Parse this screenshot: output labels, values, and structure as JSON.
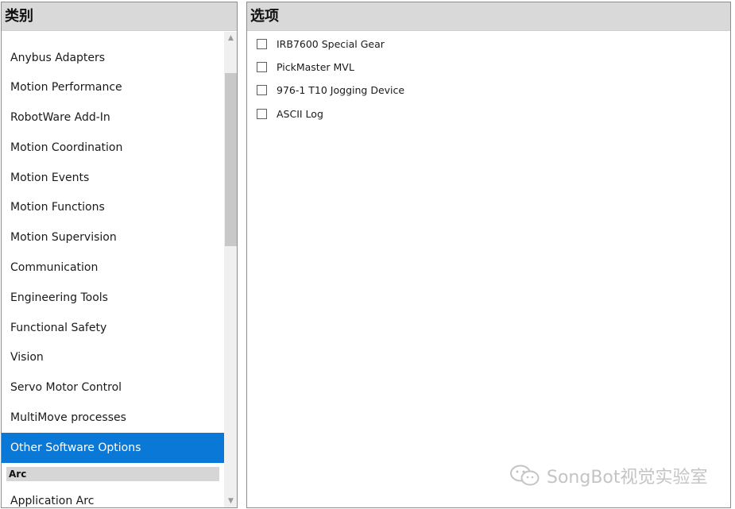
{
  "left_panel": {
    "header": "类别",
    "items": [
      "Anybus Adapters",
      "Motion Performance",
      "RobotWare Add-In",
      "Motion Coordination",
      "Motion Events",
      "Motion Functions",
      "Motion Supervision",
      "Communication",
      "Engineering Tools",
      "Functional Safety",
      "Vision",
      "Servo Motor Control",
      "MultiMove processes",
      "Other Software Options"
    ],
    "selected_item": "Other Software Options",
    "group_header": "Arc",
    "group_items": [
      "Application Arc"
    ]
  },
  "right_panel": {
    "header": "选项",
    "options": [
      {
        "label": "IRB7600 Special Gear",
        "checked": false
      },
      {
        "label": "PickMaster MVL",
        "checked": false
      },
      {
        "label": "976-1 T10 Jogging Device",
        "checked": false
      },
      {
        "label": "ASCII Log",
        "checked": false
      }
    ]
  },
  "watermark": {
    "text": "SongBot视觉实验室",
    "icon": "wechat-icon"
  },
  "colors": {
    "selected": "#0a78d7",
    "header_bg": "#d9d9d9"
  }
}
